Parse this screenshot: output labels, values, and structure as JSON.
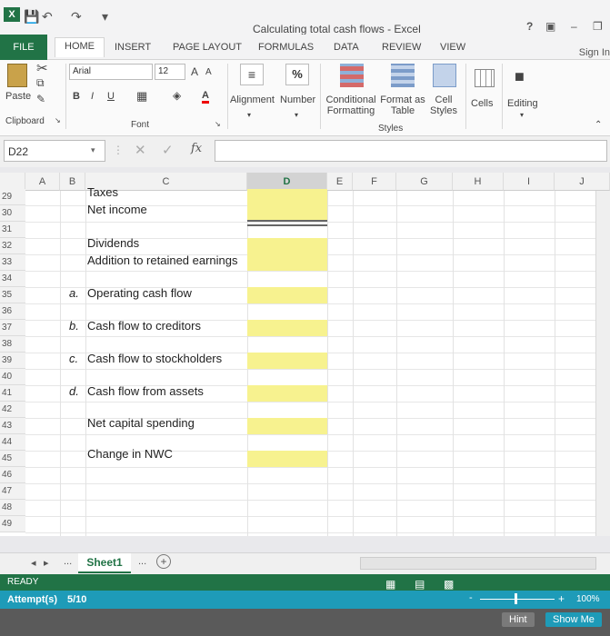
{
  "window": {
    "title": "Calculating total cash flows - Excel",
    "help": "?",
    "minimize": "–"
  },
  "tabs": [
    {
      "label": "FILE"
    },
    {
      "label": "HOME"
    },
    {
      "label": "INSERT"
    },
    {
      "label": "PAGE LAYOUT"
    },
    {
      "label": "FORMULAS"
    },
    {
      "label": "DATA"
    },
    {
      "label": "REVIEW"
    },
    {
      "label": "VIEW"
    }
  ],
  "signin": "Sign In",
  "ribbon": {
    "paste": "Paste",
    "clipboard": "Clipboard",
    "font_name": "Arial",
    "font_size": "12",
    "bold": "B",
    "italic": "I",
    "underline": "U",
    "font_group": "Font",
    "grow_font": "A",
    "shrink_font": "A",
    "font_color": "A",
    "alignment": "Alignment",
    "number": "Number",
    "number_icon": "%",
    "conditional_formatting": [
      "Conditional",
      "Formatting"
    ],
    "format_as_table": [
      "Format as",
      "Table"
    ],
    "cell_styles": [
      "Cell",
      "Styles"
    ],
    "styles_group": "Styles",
    "cells": "Cells",
    "editing": "Editing"
  },
  "formula_bar": {
    "namebox": "D22",
    "fx": "fx",
    "value": ""
  },
  "columns": [
    {
      "letter": "A"
    },
    {
      "letter": "B"
    },
    {
      "letter": "C"
    },
    {
      "letter": "D"
    },
    {
      "letter": "E"
    },
    {
      "letter": "F"
    },
    {
      "letter": "G"
    },
    {
      "letter": "H"
    },
    {
      "letter": "I"
    },
    {
      "letter": "J"
    }
  ],
  "rows": [
    "29",
    "30",
    "31",
    "32",
    "33",
    "34",
    "35",
    "36",
    "37",
    "38",
    "39",
    "40",
    "41",
    "42",
    "43",
    "44",
    "45",
    "46",
    "47",
    "48",
    "49"
  ],
  "cells": {
    "taxes": "Taxes",
    "net_income": "Net income",
    "dividends": "Dividends",
    "retained": "Addition to retained earnings",
    "ocf_letter": "a.",
    "ocf": "Operating cash flow",
    "creditors_letter": "b.",
    "creditors": "Cash flow to creditors",
    "stockholders_letter": "c.",
    "stockholders": "Cash flow to stockholders",
    "assets_letter": "d.",
    "assets": "Cash flow from assets",
    "capital": "Net capital spending",
    "nwc": "Change in NWC"
  },
  "sheets": {
    "nav_left": "◂",
    "nav_right": "▸",
    "ellipsis": "...",
    "active": "Sheet1",
    "more": "...",
    "add": "+"
  },
  "status": {
    "ready": "READY",
    "zoom": "100%",
    "zoom_plus": "+",
    "zoom_minus": "-"
  },
  "attempt": {
    "label": "Attempt(s)",
    "value": "5/10"
  },
  "buttons": {
    "hint": "Hint",
    "show_me": "Show Me"
  }
}
